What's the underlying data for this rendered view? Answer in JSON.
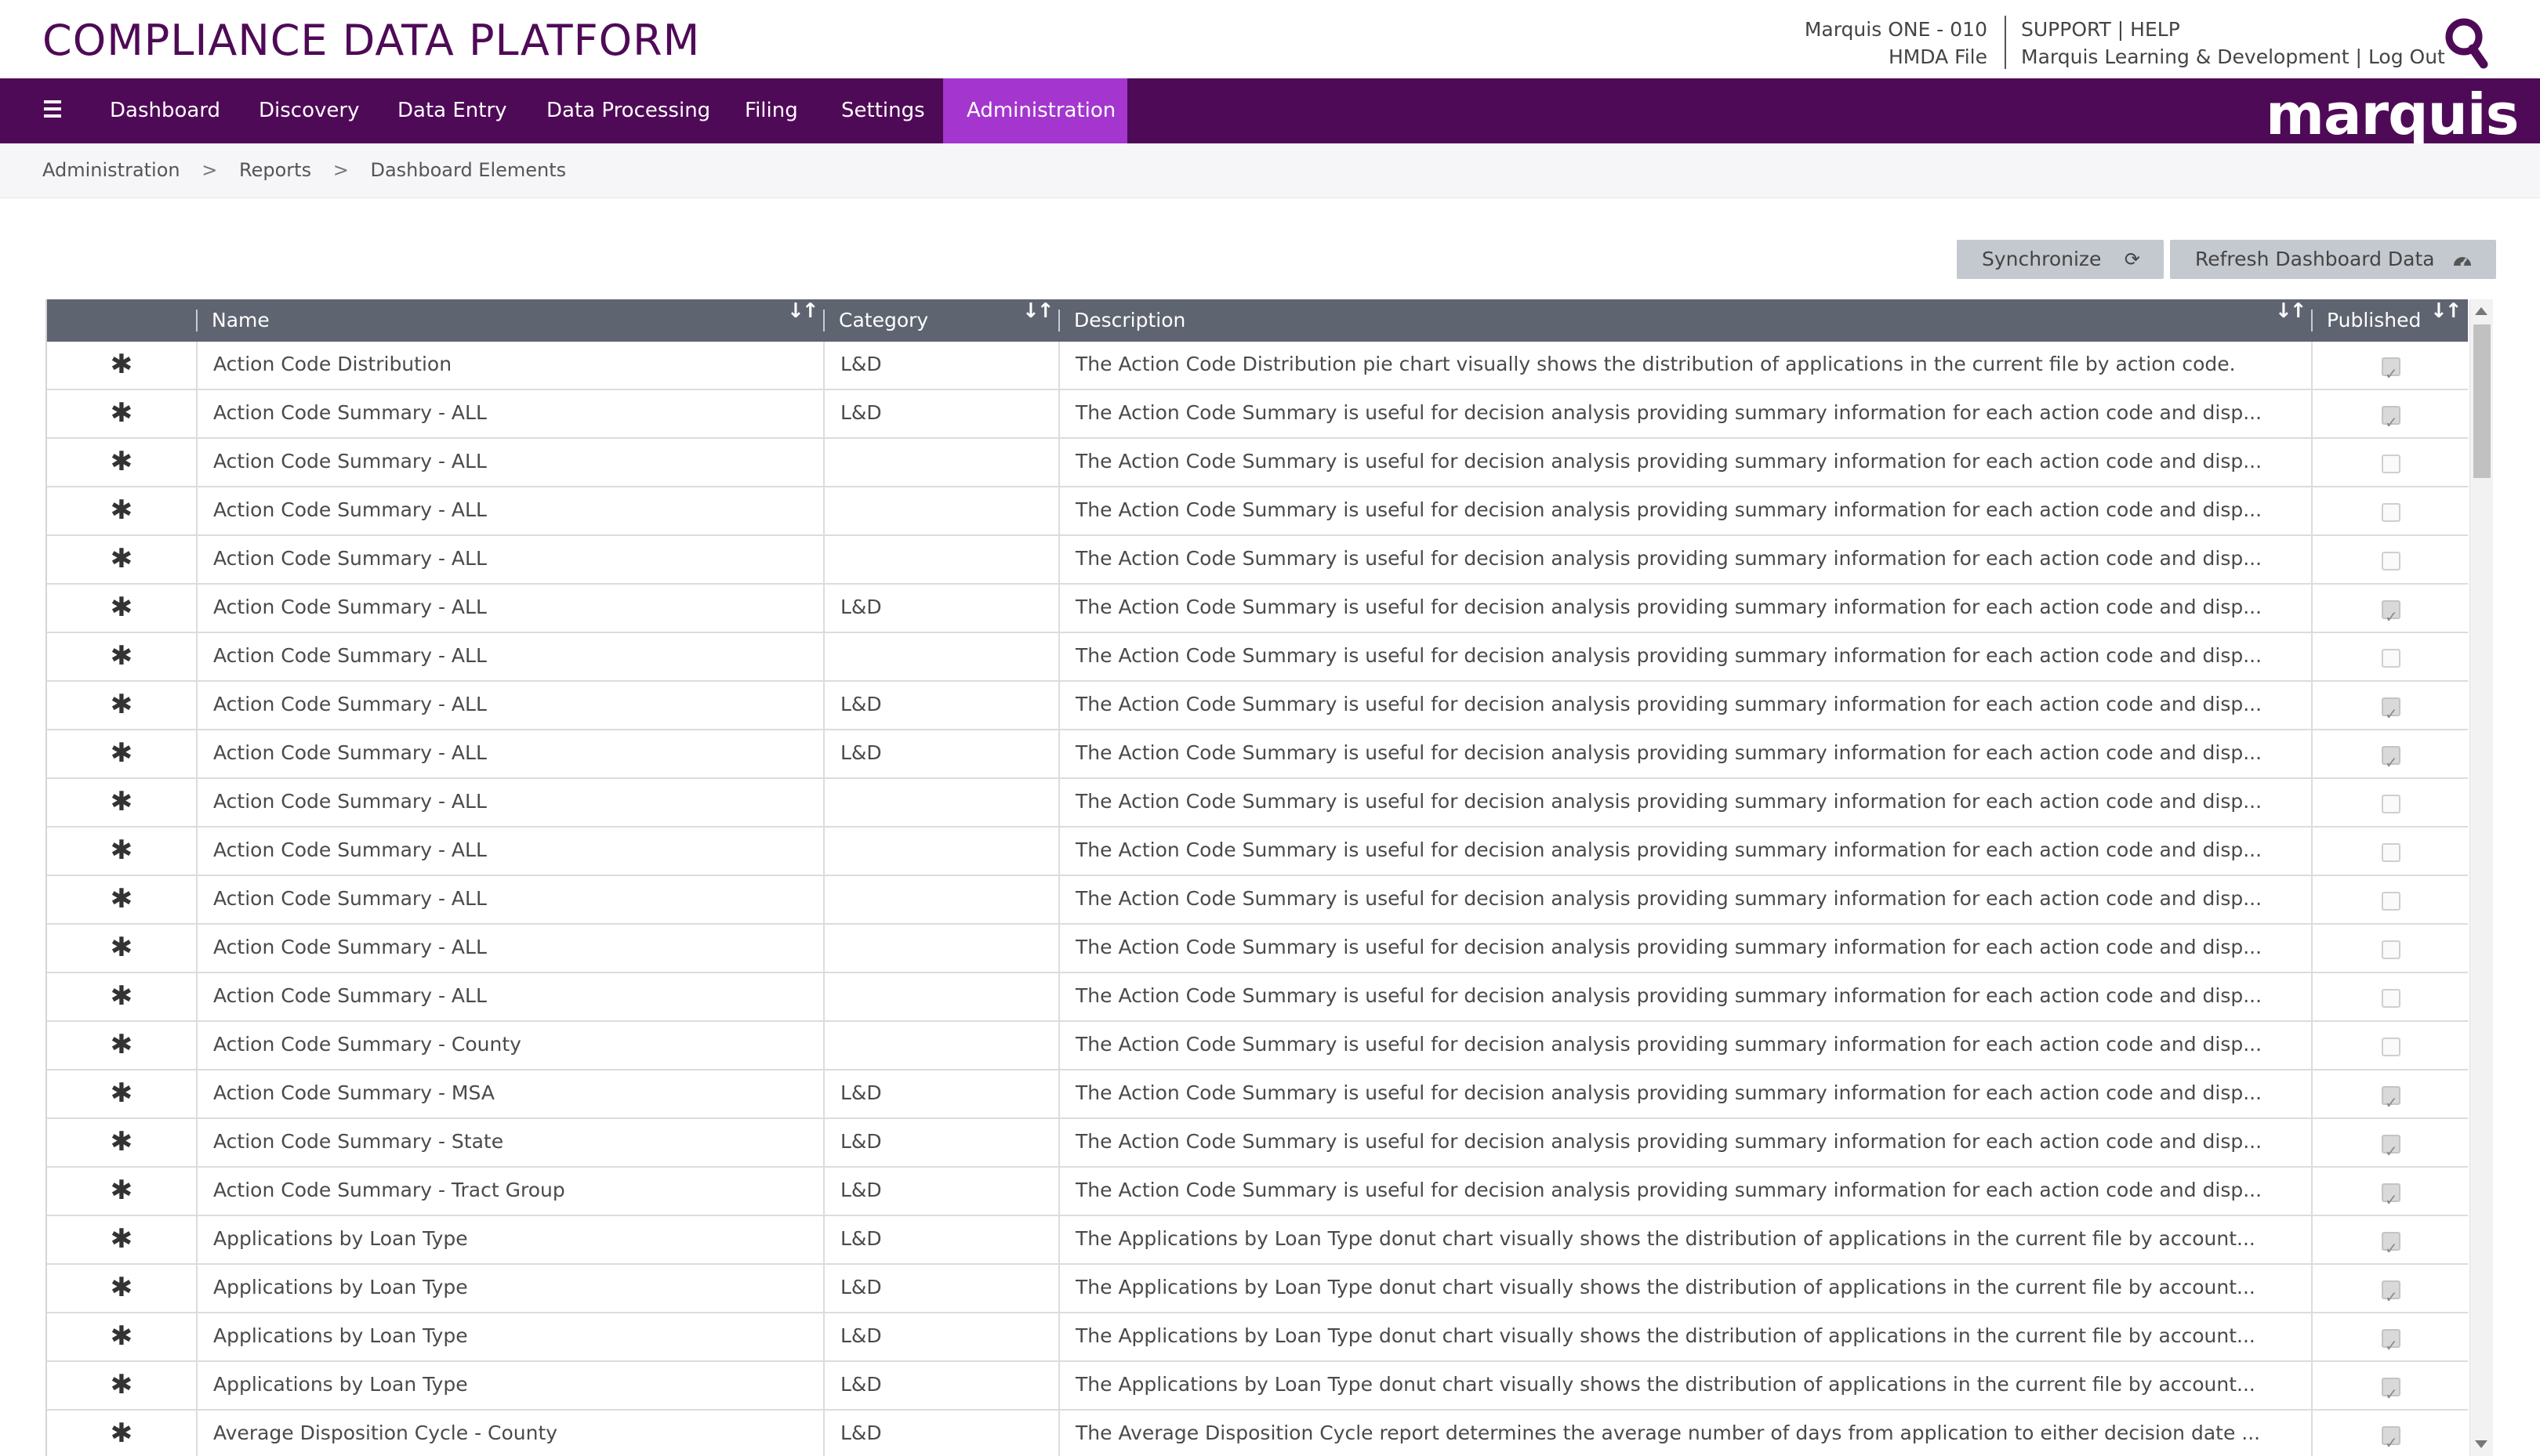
{
  "header": {
    "app_title": "COMPLIANCE DATA PLATFORM",
    "institution": "Marquis ONE - 010",
    "file": "HMDA File",
    "support": "SUPPORT",
    "help": "HELP",
    "user": "Marquis Learning & Development",
    "logout": "Log Out",
    "sep": "|"
  },
  "nav": {
    "items": [
      "Dashboard",
      "Discovery",
      "Data Entry",
      "Data Processing",
      "Filing",
      "Settings",
      "Administration"
    ],
    "active": "Administration",
    "brand": "marquis"
  },
  "breadcrumb": [
    "Administration",
    "Reports",
    "Dashboard Elements"
  ],
  "breadcrumb_sep": ">",
  "toolbar": {
    "sync_label": "Synchronize",
    "refresh_label": "Refresh Dashboard Data"
  },
  "table": {
    "columns": [
      "Name",
      "Category",
      "Description",
      "Published"
    ],
    "rows": [
      {
        "name": "Action Code Distribution",
        "category": "L&D",
        "description": "The Action Code Distribution pie chart visually shows the distribution of applications in the current file by action code.",
        "published": true
      },
      {
        "name": "Action Code Summary - ALL",
        "category": "L&D",
        "description": "The Action Code Summary is useful for decision analysis providing summary information for each action code and disp...",
        "published": true
      },
      {
        "name": "Action Code Summary - ALL",
        "category": "",
        "description": "The Action Code Summary is useful for decision analysis providing summary information for each action code and disp...",
        "published": false
      },
      {
        "name": "Action Code Summary - ALL",
        "category": "",
        "description": "The Action Code Summary is useful for decision analysis providing summary information for each action code and disp...",
        "published": false
      },
      {
        "name": "Action Code Summary - ALL",
        "category": "",
        "description": "The Action Code Summary is useful for decision analysis providing summary information for each action code and disp...",
        "published": false
      },
      {
        "name": "Action Code Summary - ALL",
        "category": "L&D",
        "description": "The Action Code Summary is useful for decision analysis providing summary information for each action code and disp...",
        "published": true
      },
      {
        "name": "Action Code Summary - ALL",
        "category": "",
        "description": "The Action Code Summary is useful for decision analysis providing summary information for each action code and disp...",
        "published": false
      },
      {
        "name": "Action Code Summary - ALL",
        "category": "L&D",
        "description": "The Action Code Summary is useful for decision analysis providing summary information for each action code and disp...",
        "published": true
      },
      {
        "name": "Action Code Summary - ALL",
        "category": "L&D",
        "description": "The Action Code Summary is useful for decision analysis providing summary information for each action code and disp...",
        "published": true
      },
      {
        "name": "Action Code Summary - ALL",
        "category": "",
        "description": "The Action Code Summary is useful for decision analysis providing summary information for each action code and disp...",
        "published": false
      },
      {
        "name": "Action Code Summary - ALL",
        "category": "",
        "description": "The Action Code Summary is useful for decision analysis providing summary information for each action code and disp...",
        "published": false
      },
      {
        "name": "Action Code Summary - ALL",
        "category": "",
        "description": "The Action Code Summary is useful for decision analysis providing summary information for each action code and disp...",
        "published": false
      },
      {
        "name": "Action Code Summary - ALL",
        "category": "",
        "description": "The Action Code Summary is useful for decision analysis providing summary information for each action code and disp...",
        "published": false
      },
      {
        "name": "Action Code Summary - ALL",
        "category": "",
        "description": "The Action Code Summary is useful for decision analysis providing summary information for each action code and disp...",
        "published": false
      },
      {
        "name": "Action Code Summary - County",
        "category": "",
        "description": "The Action Code Summary is useful for decision analysis providing summary information for each action code and disp...",
        "published": false
      },
      {
        "name": "Action Code Summary - MSA",
        "category": "L&D",
        "description": "The Action Code Summary is useful for decision analysis providing summary information for each action code and disp...",
        "published": true
      },
      {
        "name": "Action Code Summary - State",
        "category": "L&D",
        "description": "The Action Code Summary is useful for decision analysis providing summary information for each action code and disp...",
        "published": true
      },
      {
        "name": "Action Code Summary - Tract Group",
        "category": "L&D",
        "description": "The Action Code Summary is useful for decision analysis providing summary information for each action code and disp...",
        "published": true
      },
      {
        "name": "Applications by Loan Type",
        "category": "L&D",
        "description": "The Applications by Loan Type donut chart visually shows the distribution of applications in the current file by account...",
        "published": true
      },
      {
        "name": "Applications by Loan Type",
        "category": "L&D",
        "description": "The Applications by Loan Type donut chart visually shows the distribution of applications in the current file by account...",
        "published": true
      },
      {
        "name": "Applications by Loan Type",
        "category": "L&D",
        "description": "The Applications by Loan Type donut chart visually shows the distribution of applications in the current file by account...",
        "published": true
      },
      {
        "name": "Applications by Loan Type",
        "category": "L&D",
        "description": "The Applications by Loan Type donut chart visually shows the distribution of applications in the current file by account...",
        "published": true
      },
      {
        "name": "Average Disposition Cycle - County",
        "category": "L&D",
        "description": "The Average Disposition Cycle report determines the average number of days from application to either decision date ...",
        "published": true
      }
    ]
  },
  "colors": {
    "brand_purple": "#4f0a57",
    "active_tab": "#a436cf",
    "table_header": "#5e6470",
    "button_gray": "#c4c8cf"
  },
  "icons": {
    "search": "search-icon",
    "menu": "hamburger-icon",
    "sync": "refresh-icon",
    "refresh": "dashboard-gauge-icon",
    "sort": "sort-icon",
    "row": "asterisk-icon"
  }
}
